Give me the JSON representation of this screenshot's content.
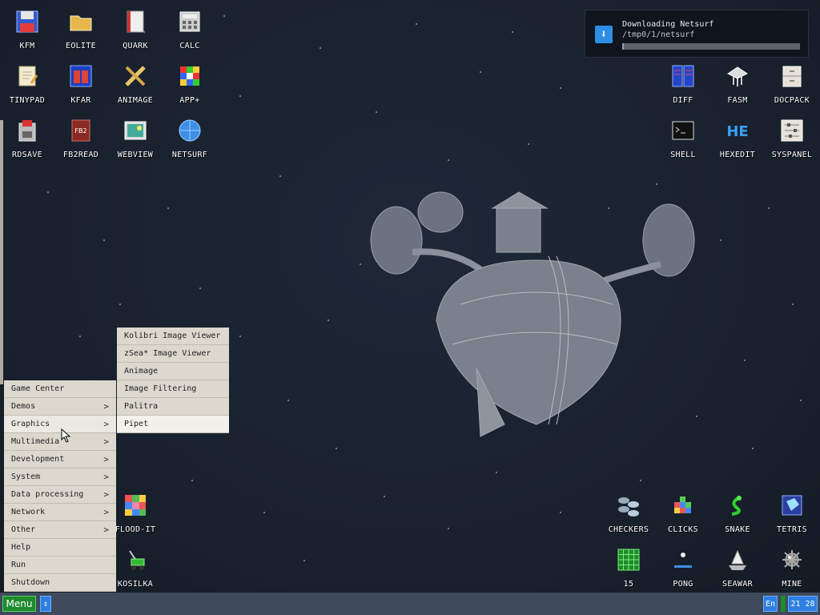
{
  "desktop_icons": [
    {
      "label": "KFM",
      "icon": "floppy-disk-icon"
    },
    {
      "label": "EOLITE",
      "icon": "folder-icon"
    },
    {
      "label": "QUARK",
      "icon": "notebook-icon"
    },
    {
      "label": "CALC",
      "icon": "calculator-icon"
    },
    {
      "label": "TINYPAD",
      "icon": "notepad-icon"
    },
    {
      "label": "KFAR",
      "icon": "archive-window-icon"
    },
    {
      "label": "ANIMAGE",
      "icon": "pencil-ruler-icon"
    },
    {
      "label": "APP+",
      "icon": "cube-icon"
    },
    {
      "label": "RDSAVE",
      "icon": "disk-save-icon"
    },
    {
      "label": "FB2READ",
      "icon": "book-icon"
    },
    {
      "label": "WEBVIEW",
      "icon": "picture-icon"
    },
    {
      "label": "NETSURF",
      "icon": "globe-icon"
    },
    {
      "label": "DIFF",
      "icon": "diff-icon"
    },
    {
      "label": "FASM",
      "icon": "assembler-icon"
    },
    {
      "label": "DOCPACK",
      "icon": "cabinet-icon"
    },
    {
      "label": "SHELL",
      "icon": "terminal-icon"
    },
    {
      "label": "HEXEDIT",
      "icon": "hex-icon"
    },
    {
      "label": "SYSPANEL",
      "icon": "sliders-icon"
    },
    {
      "label": "FLOOD-IT",
      "icon": "color-grid-icon"
    },
    {
      "label": "KOSILKA",
      "icon": "lawnmower-icon"
    },
    {
      "label": "CHECKERS",
      "icon": "checkers-icon"
    },
    {
      "label": "CLICKS",
      "icon": "blocks-icon"
    },
    {
      "label": "SNAKE",
      "icon": "snake-icon"
    },
    {
      "label": "TETRIS",
      "icon": "tetris-icon"
    },
    {
      "label": "15",
      "icon": "fifteen-puzzle-icon"
    },
    {
      "label": "PONG",
      "icon": "pong-icon"
    },
    {
      "label": "SEAWAR",
      "icon": "ship-icon"
    },
    {
      "label": "MINE",
      "icon": "mine-icon"
    }
  ],
  "notification": {
    "title": "Downloading Netsurf",
    "path": "/tmp0/1/netsurf",
    "progress": 0.01
  },
  "main_menu": {
    "items": [
      {
        "label": "Game Center",
        "submenu": false
      },
      {
        "label": "Demos",
        "submenu": true
      },
      {
        "label": "Graphics",
        "submenu": true
      },
      {
        "label": "Multimedia",
        "submenu": true
      },
      {
        "label": "Development",
        "submenu": true
      },
      {
        "label": "System",
        "submenu": true
      },
      {
        "label": "Data processing",
        "submenu": true
      },
      {
        "label": "Network",
        "submenu": true
      },
      {
        "label": "Other",
        "submenu": true
      },
      {
        "label": "Help",
        "submenu": false
      },
      {
        "label": "Run",
        "submenu": false
      },
      {
        "label": "Shutdown",
        "submenu": false
      }
    ],
    "arrow": ">"
  },
  "graphics_submenu": {
    "items": [
      "Kolibri Image Viewer",
      "zSea* Image Viewer",
      "Animage",
      "Image Filtering",
      "Palitra",
      "Pipet"
    ]
  },
  "taskbar": {
    "menu_label": "Menu",
    "switch_label": "⇕",
    "language": "En",
    "clock": "21 28"
  },
  "colors": {
    "desktop_bg": "#1a2230",
    "menu_bg": "#dcd8ce",
    "taskbar_bg": "#3f4a5c",
    "accent_green": "#1f8b2e",
    "accent_blue": "#2e7fe0"
  }
}
